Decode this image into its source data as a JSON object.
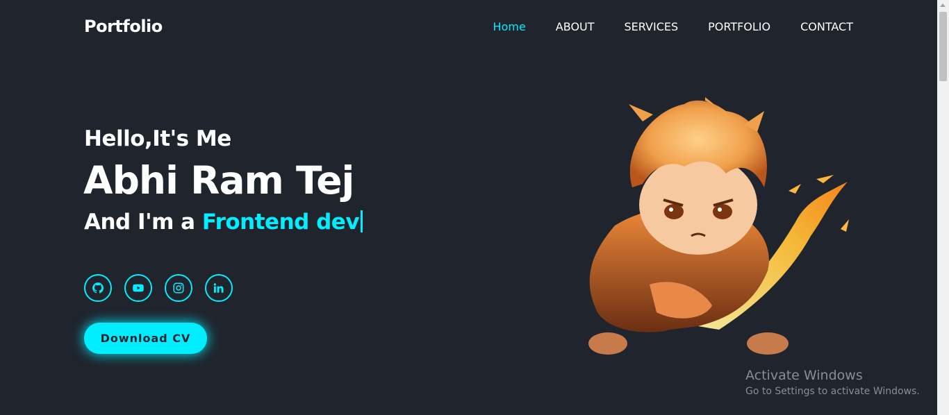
{
  "header": {
    "logo": "Portfolio",
    "nav": [
      "Home",
      "ABOUT",
      "SERVICES",
      "PORTFOLIO",
      "CONTACT"
    ],
    "active_nav": "Home"
  },
  "hero": {
    "greeting": "Hello,It's Me",
    "name": "Abhi Ram Tej",
    "role_prefix": "And I'm a ",
    "role_highlight": "Frontend dev",
    "social_icons": [
      "github-icon",
      "youtube-icon",
      "instagram-icon",
      "linkedin-icon"
    ],
    "cv_button": "Download CV"
  },
  "watermark": {
    "title": "Activate Windows",
    "subtitle": "Go to Settings to activate Windows."
  },
  "colors": {
    "background": "#1f242d",
    "accent": "#00eeff",
    "text": "#ffffff"
  }
}
